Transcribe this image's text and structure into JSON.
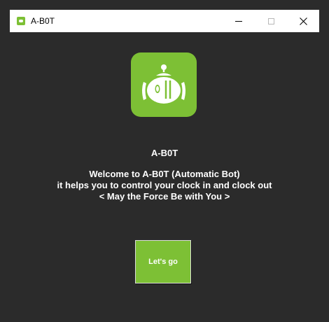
{
  "window": {
    "title": "A-B0T",
    "icon": "robot-icon",
    "controls": [
      "minimize-icon",
      "maximize-icon",
      "close-icon"
    ]
  },
  "main": {
    "logo_icon": "robot-icon",
    "app_name": "A-B0T",
    "welcome_lines": [
      "Welcome to A-B0T (Automatic Bot)",
      "it helps you to control your clock in and clock out",
      "< May the Force Be with You >"
    ],
    "start_button_label": "Let's go"
  },
  "colors": {
    "accent": "#7dc035",
    "background": "#2b2b2b",
    "text": "#ffffff"
  }
}
